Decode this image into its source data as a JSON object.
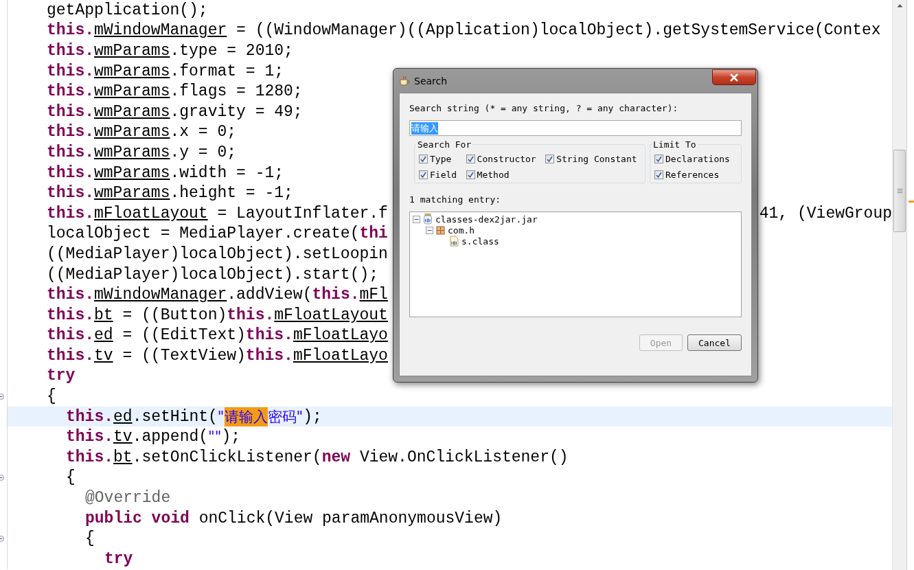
{
  "editor": {
    "lines": [
      {
        "tokens": [
          {
            "kind": "plain",
            "text": "getApplication();"
          }
        ]
      },
      {
        "tokens": [
          {
            "kind": "kw",
            "text": "this."
          },
          {
            "kind": "field",
            "text": "mWindowManager"
          },
          {
            "kind": "plain",
            "text": " = ((WindowManager)((Application)localObject).getSystemService(Contex"
          }
        ]
      },
      {
        "tokens": [
          {
            "kind": "kw",
            "text": "this."
          },
          {
            "kind": "field",
            "text": "wmParams"
          },
          {
            "kind": "plain",
            "text": ".type = 2010;"
          }
        ]
      },
      {
        "tokens": [
          {
            "kind": "kw",
            "text": "this."
          },
          {
            "kind": "field",
            "text": "wmParams"
          },
          {
            "kind": "plain",
            "text": ".format = 1;"
          }
        ]
      },
      {
        "tokens": [
          {
            "kind": "kw",
            "text": "this."
          },
          {
            "kind": "field",
            "text": "wmParams"
          },
          {
            "kind": "plain",
            "text": ".flags = 1280;"
          }
        ]
      },
      {
        "tokens": [
          {
            "kind": "kw",
            "text": "this."
          },
          {
            "kind": "field",
            "text": "wmParams"
          },
          {
            "kind": "plain",
            "text": ".gravity = 49;"
          }
        ]
      },
      {
        "tokens": [
          {
            "kind": "kw",
            "text": "this."
          },
          {
            "kind": "field",
            "text": "wmParams"
          },
          {
            "kind": "plain",
            "text": ".x = 0;"
          }
        ]
      },
      {
        "tokens": [
          {
            "kind": "kw",
            "text": "this."
          },
          {
            "kind": "field",
            "text": "wmParams"
          },
          {
            "kind": "plain",
            "text": ".y = 0;"
          }
        ]
      },
      {
        "tokens": [
          {
            "kind": "kw",
            "text": "this."
          },
          {
            "kind": "field",
            "text": "wmParams"
          },
          {
            "kind": "plain",
            "text": ".width = -1;"
          }
        ]
      },
      {
        "tokens": [
          {
            "kind": "kw",
            "text": "this."
          },
          {
            "kind": "field",
            "text": "wmParams"
          },
          {
            "kind": "plain",
            "text": ".height = -1;"
          }
        ]
      },
      {
        "tokens": [
          {
            "kind": "kw",
            "text": "this."
          },
          {
            "kind": "field",
            "text": "mFloatLayout"
          },
          {
            "kind": "plain",
            "text": " = LayoutInflater.f"
          }
        ],
        "tail": "41, (ViewGroup"
      },
      {
        "tokens": [
          {
            "kind": "plain",
            "text": "localObject = MediaPlayer.create("
          },
          {
            "kind": "kw",
            "text": "thi"
          }
        ]
      },
      {
        "tokens": [
          {
            "kind": "plain",
            "text": "((MediaPlayer)localObject).setLoopin"
          }
        ]
      },
      {
        "tokens": [
          {
            "kind": "plain",
            "text": "((MediaPlayer)localObject).start();"
          }
        ]
      },
      {
        "tokens": [
          {
            "kind": "kw",
            "text": "this."
          },
          {
            "kind": "field",
            "text": "mWindowManager"
          },
          {
            "kind": "plain",
            "text": ".addView("
          },
          {
            "kind": "kw",
            "text": "this."
          },
          {
            "kind": "field",
            "text": "mFl"
          }
        ]
      },
      {
        "tokens": [
          {
            "kind": "kw",
            "text": "this."
          },
          {
            "kind": "field",
            "text": "bt"
          },
          {
            "kind": "plain",
            "text": " = ((Button)"
          },
          {
            "kind": "kw",
            "text": "this."
          },
          {
            "kind": "field",
            "text": "mFloatLayout"
          }
        ]
      },
      {
        "tokens": [
          {
            "kind": "kw",
            "text": "this."
          },
          {
            "kind": "field",
            "text": "ed"
          },
          {
            "kind": "plain",
            "text": " = ((EditText)"
          },
          {
            "kind": "kw",
            "text": "this."
          },
          {
            "kind": "field",
            "text": "mFloatLayo"
          }
        ]
      },
      {
        "tokens": [
          {
            "kind": "kw",
            "text": "this."
          },
          {
            "kind": "field",
            "text": "tv"
          },
          {
            "kind": "plain",
            "text": " = ((TextView)"
          },
          {
            "kind": "kw",
            "text": "this."
          },
          {
            "kind": "field",
            "text": "mFloatLayo"
          }
        ]
      },
      {
        "tokens": [
          {
            "kind": "kw",
            "text": "try"
          }
        ]
      },
      {
        "fold": true,
        "tokens": [
          {
            "kind": "plain",
            "text": "{"
          }
        ],
        "children": [
          {
            "current": true,
            "tokens": [
              {
                "kind": "kw",
                "text": "this."
              },
              {
                "kind": "field",
                "text": "ed"
              },
              {
                "kind": "plain",
                "text": ".setHint("
              },
              {
                "kind": "string",
                "text": "\""
              },
              {
                "kind": "match",
                "text": "请输入"
              },
              {
                "kind": "string",
                "text": "密码\""
              },
              {
                "kind": "plain",
                "text": ");"
              }
            ]
          },
          {
            "tokens": [
              {
                "kind": "kw",
                "text": "this."
              },
              {
                "kind": "field",
                "text": "tv"
              },
              {
                "kind": "plain",
                "text": ".append("
              },
              {
                "kind": "string",
                "text": "\"\""
              },
              {
                "kind": "plain",
                "text": ");"
              }
            ]
          },
          {
            "tokens": [
              {
                "kind": "kw",
                "text": "this."
              },
              {
                "kind": "field",
                "text": "bt"
              },
              {
                "kind": "plain",
                "text": ".setOnClickListener("
              },
              {
                "kind": "kw",
                "text": "new"
              },
              {
                "kind": "plain",
                "text": " View.OnClickListener()"
              }
            ]
          },
          {
            "fold": true,
            "tokens": [
              {
                "kind": "plain",
                "text": "{"
              }
            ],
            "children": [
              {
                "tokens": [
                  {
                    "kind": "annotation",
                    "text": "@Override"
                  }
                ]
              },
              {
                "tokens": [
                  {
                    "kind": "kw",
                    "text": "public void"
                  },
                  {
                    "kind": "plain",
                    "text": " onClick(View paramAnonymousView)"
                  }
                ]
              },
              {
                "fold": true,
                "tokens": [
                  {
                    "kind": "plain",
                    "text": "{"
                  }
                ],
                "children": [
                  {
                    "tokens": [
                      {
                        "kind": "kw",
                        "text": "try"
                      }
                    ]
                  }
                ]
              }
            ]
          }
        ]
      }
    ]
  },
  "dialog": {
    "title": "Search",
    "search_label": "Search string (* = any string, ? = any character):",
    "search_value": "请输入",
    "search_for": {
      "title": "Search For",
      "options": [
        {
          "label": "Type",
          "checked": true
        },
        {
          "label": "Constructor",
          "checked": true
        },
        {
          "label": "String Constant",
          "checked": true
        },
        {
          "label": "Field",
          "checked": true
        },
        {
          "label": "Method",
          "checked": true
        }
      ]
    },
    "limit_to": {
      "title": "Limit To",
      "options": [
        {
          "label": "Declarations",
          "checked": true
        },
        {
          "label": "References",
          "checked": true
        }
      ]
    },
    "matches_label": "1 matching entry:",
    "tree": [
      {
        "kind": "jar",
        "label": "classes-dex2jar.jar",
        "expanded": true,
        "children": [
          {
            "kind": "package",
            "label": "com.h",
            "expanded": true,
            "children": [
              {
                "kind": "class",
                "label": "s.class"
              }
            ]
          }
        ]
      }
    ],
    "buttons": [
      {
        "label": "Open",
        "disabled": true
      },
      {
        "label": "Cancel",
        "disabled": false
      }
    ]
  }
}
